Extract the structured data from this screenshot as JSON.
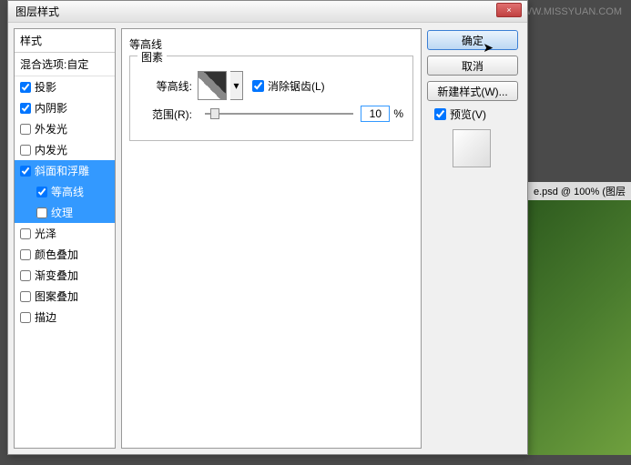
{
  "watermark": "思缘设计论坛  WWW.MISSYUAN.COM",
  "bgTab": "e.psd @ 100% (图层",
  "dialog": {
    "title": "图层样式",
    "close": "×"
  },
  "left": {
    "header": "样式",
    "blendOptions": "混合选项:自定",
    "items": [
      {
        "label": "投影",
        "checked": true,
        "selected": false,
        "indent": false
      },
      {
        "label": "内阴影",
        "checked": true,
        "selected": false,
        "indent": false
      },
      {
        "label": "外发光",
        "checked": false,
        "selected": false,
        "indent": false
      },
      {
        "label": "内发光",
        "checked": false,
        "selected": false,
        "indent": false
      },
      {
        "label": "斜面和浮雕",
        "checked": true,
        "selected": true,
        "indent": false
      },
      {
        "label": "等高线",
        "checked": true,
        "selected": true,
        "indent": true
      },
      {
        "label": "纹理",
        "checked": false,
        "selected": true,
        "indent": true
      },
      {
        "label": "光泽",
        "checked": false,
        "selected": false,
        "indent": false
      },
      {
        "label": "颜色叠加",
        "checked": false,
        "selected": false,
        "indent": false
      },
      {
        "label": "渐变叠加",
        "checked": false,
        "selected": false,
        "indent": false
      },
      {
        "label": "图案叠加",
        "checked": false,
        "selected": false,
        "indent": false
      },
      {
        "label": "描边",
        "checked": false,
        "selected": false,
        "indent": false
      }
    ]
  },
  "center": {
    "groupTitle": "等高线",
    "elementsTitle": "图素",
    "contourLabel": "等高线:",
    "antiAlias": "消除锯齿(L)",
    "antiAliasChecked": true,
    "rangeLabel": "范围(R):",
    "rangeValue": "10",
    "percent": "%"
  },
  "right": {
    "ok": "确定",
    "cancel": "取消",
    "newStyle": "新建样式(W)...",
    "preview": "预览(V)",
    "previewChecked": true
  }
}
